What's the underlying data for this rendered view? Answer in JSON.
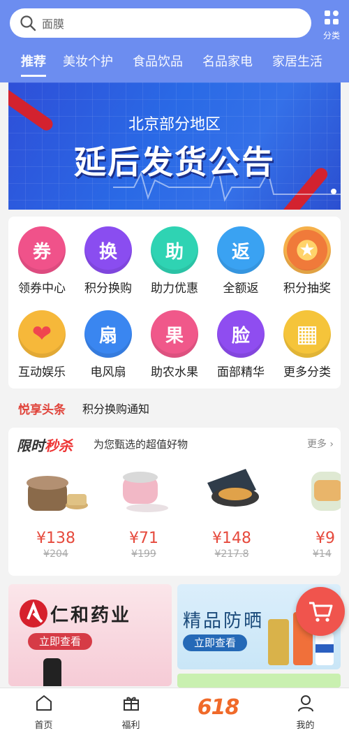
{
  "search": {
    "placeholder": "面膜"
  },
  "category_button": {
    "label": "分类"
  },
  "tabs": [
    {
      "label": "推荐"
    },
    {
      "label": "美妆个护"
    },
    {
      "label": "食品饮品"
    },
    {
      "label": "名品家电"
    },
    {
      "label": "家居生活"
    }
  ],
  "banner": {
    "subtitle": "北京部分地区",
    "title": "延后发货公告"
  },
  "shortcuts": [
    {
      "label": "领券中心",
      "glyph": "券",
      "color": "#f0528a",
      "icon": "coupon-icon"
    },
    {
      "label": "积分换购",
      "glyph": "换",
      "color": "#8a4df0",
      "icon": "exchange-icon"
    },
    {
      "label": "助力优惠",
      "glyph": "助",
      "color": "#2fd3b3",
      "icon": "assist-icon"
    },
    {
      "label": "全额返",
      "glyph": "返",
      "color": "#3aa2f2",
      "icon": "refund-icon"
    },
    {
      "label": "积分抽奖",
      "glyph": "★",
      "color": "#f07a3a",
      "icon": "lottery-wheel-icon"
    },
    {
      "label": "互动娱乐",
      "glyph": "❤",
      "color": "#f6b83a",
      "icon": "heart-icon"
    },
    {
      "label": "电风扇",
      "glyph": "扇",
      "color": "#3a86f0",
      "icon": "fan-icon"
    },
    {
      "label": "助农水果",
      "glyph": "果",
      "color": "#f0588a",
      "icon": "fruit-icon"
    },
    {
      "label": "面部精华",
      "glyph": "脸",
      "color": "#8f4df0",
      "icon": "serum-icon"
    },
    {
      "label": "更多分类",
      "glyph": "▦",
      "color": "#f5c43a",
      "icon": "grid-icon"
    }
  ],
  "news": {
    "tag": "悦享头条",
    "text": "积分换购通知"
  },
  "flash_sale": {
    "title_part1": "限时",
    "title_part2": "秒杀",
    "subtitle": "为您甄选的超值好物",
    "more": "更多",
    "products": [
      {
        "price": "¥138",
        "original": "¥204",
        "icon": "rice-cooker-icon"
      },
      {
        "price": "¥71",
        "original": "¥199",
        "icon": "steamer-icon"
      },
      {
        "price": "¥148",
        "original": "¥217.8",
        "icon": "waffle-maker-icon"
      },
      {
        "price": "¥9",
        "original": "¥14",
        "icon": "kettle-icon"
      }
    ]
  },
  "promos": [
    {
      "title": "仁和药业",
      "button": "立即查看",
      "icon": "renhe-logo-icon"
    },
    {
      "title": "精品防晒",
      "button": "立即查看",
      "icon": "sunscreen-icon"
    }
  ],
  "tabbar": [
    {
      "label": "首页",
      "icon": "home-icon"
    },
    {
      "label": "福利",
      "icon": "gift-icon"
    },
    {
      "label": "618",
      "icon": "618-logo"
    },
    {
      "label": "我的",
      "icon": "user-icon"
    }
  ]
}
